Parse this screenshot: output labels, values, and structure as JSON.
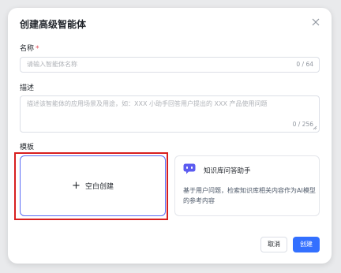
{
  "dialog": {
    "title": "创建高级智能体"
  },
  "name_field": {
    "label": "名称",
    "required_mark": "*",
    "placeholder": "请输入智能体名称",
    "counter": "0 / 64"
  },
  "description_field": {
    "label": "描述",
    "placeholder": "描述该智能体的应用场景及用途，如：XXX 小助手回答用户提出的 XXX 产品使用问题",
    "counter": "0 / 256"
  },
  "template": {
    "label": "模板",
    "blank_card": {
      "plus": "+",
      "label": "空白创建"
    },
    "kb_card": {
      "icon": "robot-icon",
      "name": "知识库问答助手",
      "description": "基于用户问题，检索知识库相关内容作为AI模型的参考内容"
    }
  },
  "footer": {
    "cancel_label": "取消",
    "create_label": "创建"
  },
  "colors": {
    "primary": "#3370ff",
    "selected_border": "#5b6cf5",
    "highlight": "#d81f1f",
    "robot_icon": "#5b5bf0"
  }
}
